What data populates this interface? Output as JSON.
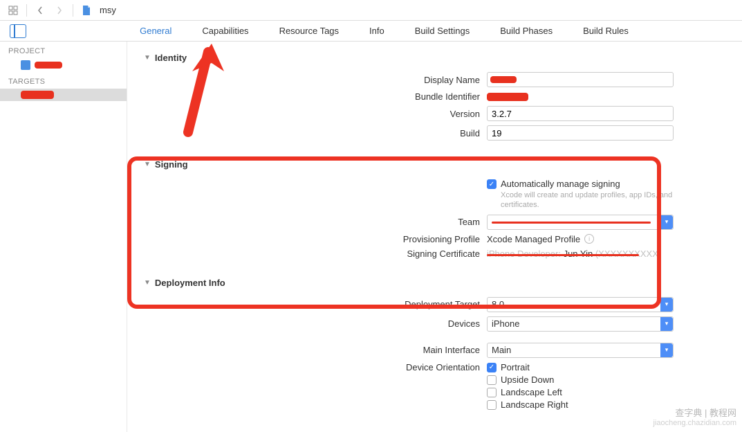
{
  "toolbar": {
    "file_name": "msy"
  },
  "tabs": {
    "general": "General",
    "capabilities": "Capabilities",
    "resource_tags": "Resource Tags",
    "info": "Info",
    "build_settings": "Build Settings",
    "build_phases": "Build Phases",
    "build_rules": "Build Rules"
  },
  "sidebar": {
    "project_label": "PROJECT",
    "targets_label": "TARGETS"
  },
  "sections": {
    "identity": {
      "title": "Identity",
      "display_name_label": "Display Name",
      "bundle_id_label": "Bundle Identifier",
      "version_label": "Version",
      "version_value": "3.2.7",
      "build_label": "Build",
      "build_value": "19"
    },
    "signing": {
      "title": "Signing",
      "auto_label": "Automatically manage signing",
      "auto_help": "Xcode will create and update profiles, app IDs, and certificates.",
      "team_label": "Team",
      "team_value": "",
      "provisioning_label": "Provisioning Profile",
      "provisioning_value": "Xcode Managed Profile",
      "signing_cert_label": "Signing Certificate",
      "signing_cert_value_partial": "Jun Yin"
    },
    "deployment": {
      "title": "Deployment Info",
      "target_label": "Deployment Target",
      "target_value": "8.0",
      "devices_label": "Devices",
      "devices_value": "iPhone",
      "main_interface_label": "Main Interface",
      "main_interface_value": "Main",
      "orientation_label": "Device Orientation",
      "orient_portrait": "Portrait",
      "orient_upside": "Upside Down",
      "orient_ls_left": "Landscape Left",
      "orient_ls_right": "Landscape Right"
    }
  },
  "watermark": {
    "cn": "查字典 | 教程网",
    "url": "jiaocheng.chazidian.com"
  }
}
